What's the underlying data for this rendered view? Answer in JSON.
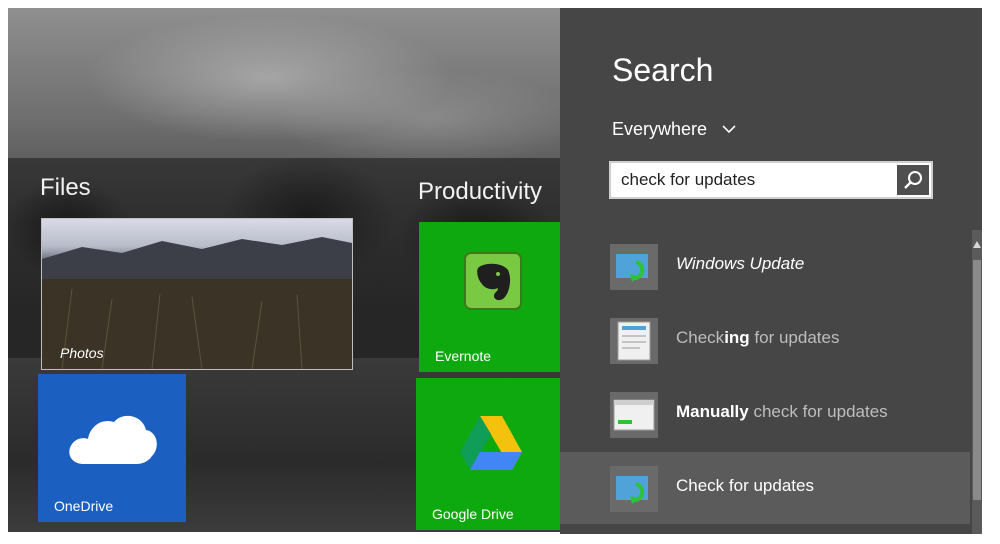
{
  "start": {
    "groups": [
      {
        "title": "Files"
      },
      {
        "title": "Productivity"
      }
    ],
    "tiles": {
      "photos": {
        "label": "Photos"
      },
      "onedrive": {
        "label": "OneDrive"
      },
      "evernote": {
        "label": "Evernote"
      },
      "gdrive": {
        "label": "Google Drive"
      }
    }
  },
  "charm": {
    "title": "Search",
    "scope": "Everywhere",
    "search": {
      "value": "check for updates",
      "placeholder": ""
    },
    "results": [
      {
        "prefix": "",
        "strong": "",
        "suffix": "Windows Update",
        "style": "italic"
      },
      {
        "prefix": "Check",
        "strong": "ing",
        "suffix": " for updates",
        "style": "dim"
      },
      {
        "prefix": "",
        "strong": "Manually",
        "suffix": " check for updates",
        "style": "dim-mixed"
      },
      {
        "prefix": "Check for updates",
        "strong": "",
        "suffix": "",
        "style": "selected"
      }
    ]
  },
  "colors": {
    "charm_bg": "#464646",
    "selected_bg": "#5b5b5b",
    "onedrive_tile": "#1b5fc0",
    "green_tile": "#0ea90e"
  },
  "icons": {
    "scope": "chevron-down-icon",
    "search": "magnifier-icon",
    "onedrive": "cloud-icon",
    "evernote": "elephant-icon",
    "gdrive": "drive-triangle-icon",
    "result_update": "windows-update-icon",
    "result_doc": "control-panel-icon"
  }
}
